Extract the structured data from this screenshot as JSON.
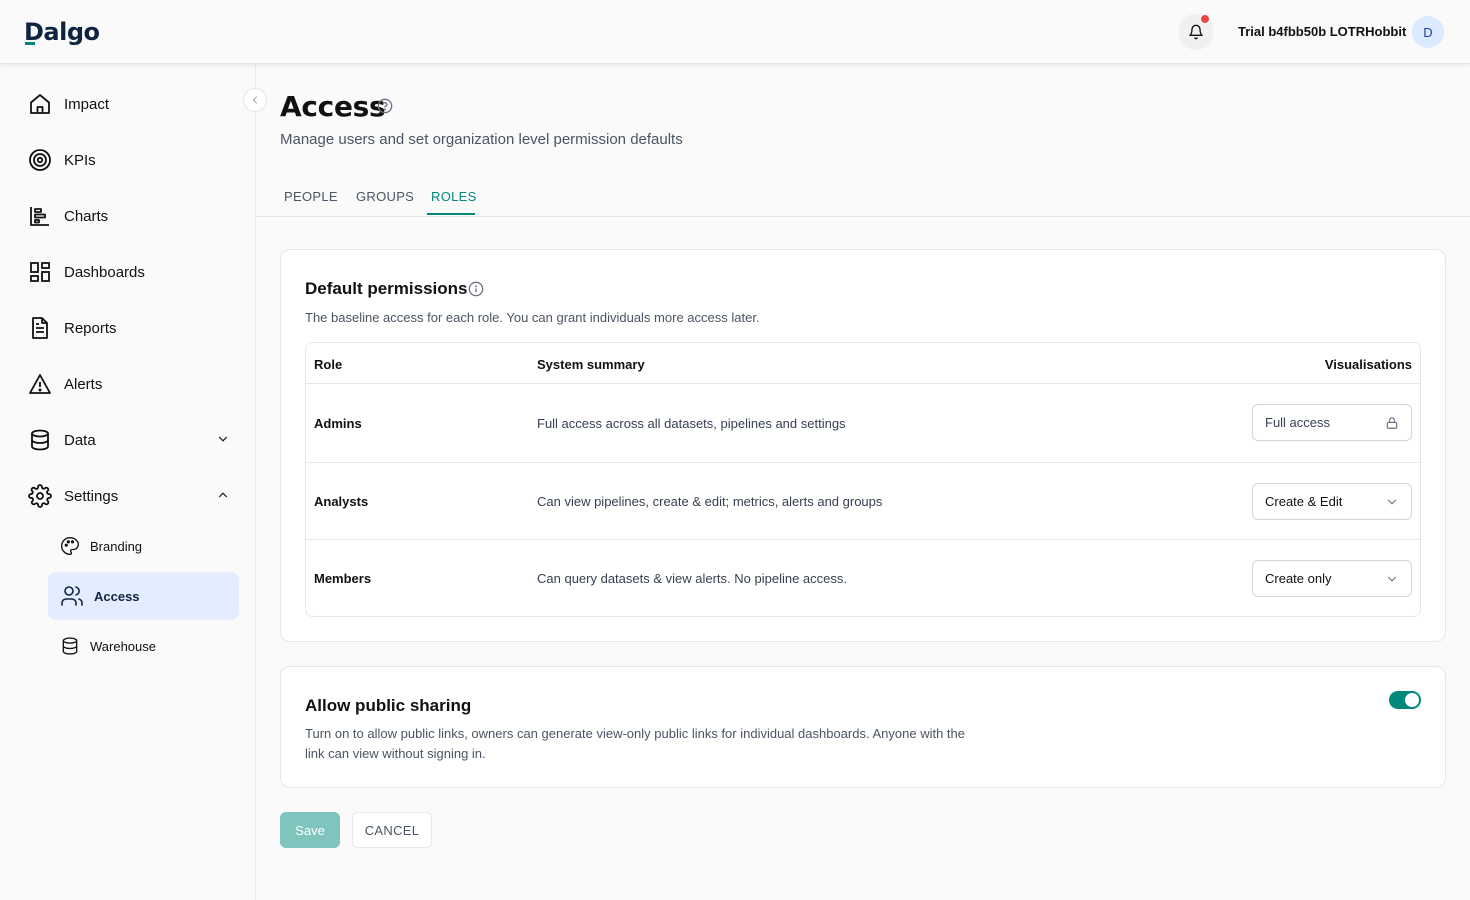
{
  "brand": {
    "logo_text": "Dalgo",
    "accent": "#00897b"
  },
  "header": {
    "user_name": "Trial b4fbb50b LOTRHobbit",
    "avatar_initial": "D",
    "notification_icon": "bell-icon",
    "has_unread": true
  },
  "sidebar": {
    "items": [
      {
        "label": "Impact",
        "icon": "home-icon"
      },
      {
        "label": "KPIs",
        "icon": "target-icon"
      },
      {
        "label": "Charts",
        "icon": "bar-chart-icon"
      },
      {
        "label": "Dashboards",
        "icon": "dashboard-grid-icon"
      },
      {
        "label": "Reports",
        "icon": "document-icon"
      },
      {
        "label": "Alerts",
        "icon": "warning-icon"
      },
      {
        "label": "Data",
        "icon": "database-icon",
        "expanded": false
      },
      {
        "label": "Settings",
        "icon": "gear-icon",
        "expanded": true
      }
    ],
    "settings_children": [
      {
        "label": "Branding",
        "icon": "palette-icon",
        "active": false
      },
      {
        "label": "Access",
        "icon": "users-icon",
        "active": true
      },
      {
        "label": "Warehouse",
        "icon": "database-icon",
        "active": false
      }
    ]
  },
  "page": {
    "title": "Access",
    "subtitle": "Manage users and set organization level permission defaults"
  },
  "tabs": [
    {
      "label": "PEOPLE",
      "active": false
    },
    {
      "label": "GROUPS",
      "active": false
    },
    {
      "label": "ROLES",
      "active": true
    }
  ],
  "default_permissions": {
    "title": "Default permissions",
    "description": "The baseline access for each role. You can grant individuals more access later.",
    "columns": {
      "role": "Role",
      "summary": "System summary",
      "visualisations": "Visualisations"
    },
    "rows": [
      {
        "role": "Admins",
        "summary": "Full access across all datasets, pipelines and settings",
        "access": "Full access",
        "locked": true
      },
      {
        "role": "Analysts",
        "summary": "Can view pipelines, create & edit; metrics, alerts and groups",
        "access": "Create & Edit",
        "locked": false
      },
      {
        "role": "Members",
        "summary": "Can query datasets & view alerts. No pipeline access.",
        "access": "Create only",
        "locked": false
      }
    ]
  },
  "public_sharing": {
    "title": "Allow public sharing",
    "description_line1": "Turn on to allow public links, owners can generate view-only public links for individual dashboards. Anyone with the",
    "description_line2": "link can view without signing in.",
    "enabled": true
  },
  "actions": {
    "save": "Save",
    "cancel": "CANCEL"
  }
}
